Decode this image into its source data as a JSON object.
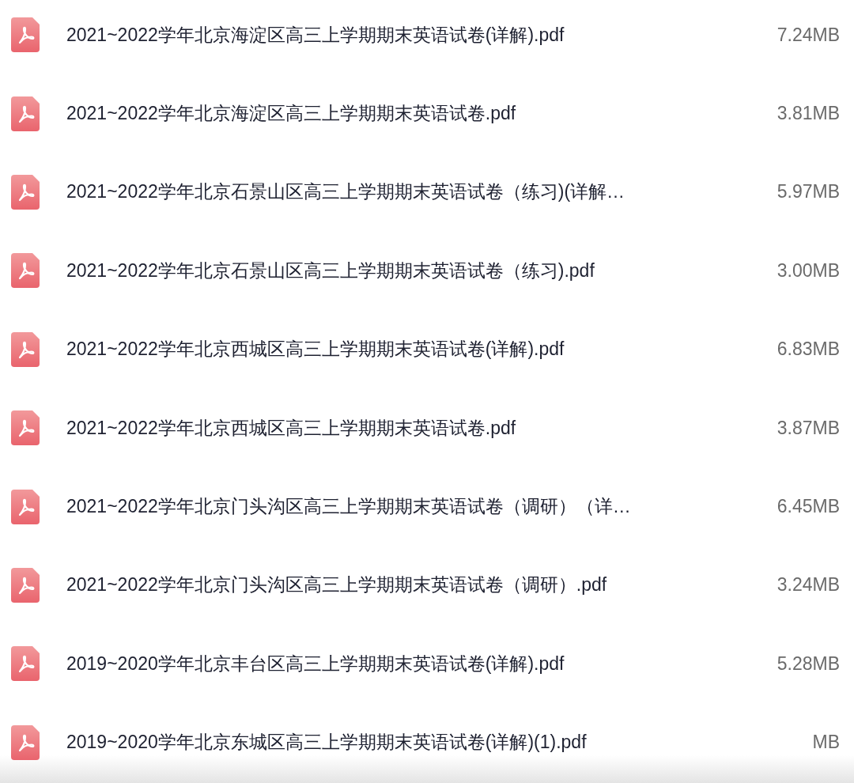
{
  "files": [
    {
      "name": "2021~2022学年北京海淀区高三上学期期末英语试卷(详解).pdf",
      "size": "7.24MB"
    },
    {
      "name": "2021~2022学年北京海淀区高三上学期期末英语试卷.pdf",
      "size": "3.81MB"
    },
    {
      "name": "2021~2022学年北京石景山区高三上学期期末英语试卷（练习)(详解…",
      "size": "5.97MB"
    },
    {
      "name": "2021~2022学年北京石景山区高三上学期期末英语试卷（练习).pdf",
      "size": "3.00MB"
    },
    {
      "name": "2021~2022学年北京西城区高三上学期期末英语试卷(详解).pdf",
      "size": "6.83MB"
    },
    {
      "name": "2021~2022学年北京西城区高三上学期期末英语试卷.pdf",
      "size": "3.87MB"
    },
    {
      "name": "2021~2022学年北京门头沟区高三上学期期末英语试卷（调研）（详…",
      "size": "6.45MB"
    },
    {
      "name": "2021~2022学年北京门头沟区高三上学期期末英语试卷（调研）.pdf",
      "size": "3.24MB"
    },
    {
      "name": "2019~2020学年北京丰台区高三上学期期末英语试卷(详解).pdf",
      "size": "5.28MB"
    },
    {
      "name": "2019~2020学年北京东城区高三上学期期末英语试卷(详解)(1).pdf",
      "size": "MB"
    }
  ]
}
